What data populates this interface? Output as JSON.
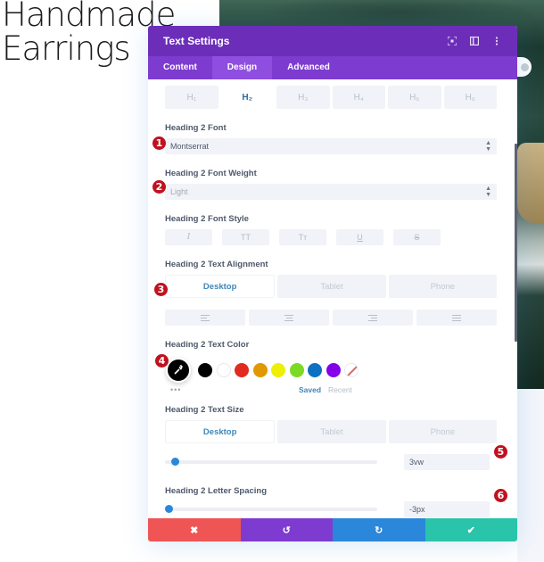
{
  "page": {
    "title_lines": [
      "Handmade",
      "Earrings"
    ]
  },
  "modal": {
    "title": "Text Settings",
    "header_icons": [
      "expand-icon",
      "split-view-icon",
      "more-options-icon"
    ],
    "tabs": [
      {
        "label": "Content",
        "active": false
      },
      {
        "label": "Design",
        "active": true
      },
      {
        "label": "Advanced",
        "active": false
      }
    ],
    "heading_levels": [
      {
        "label": "H₁",
        "active": false
      },
      {
        "label": "H₂",
        "active": true
      },
      {
        "label": "H₃",
        "active": false
      },
      {
        "label": "H₄",
        "active": false
      },
      {
        "label": "H₅",
        "active": false
      },
      {
        "label": "H₆",
        "active": false
      }
    ],
    "font": {
      "label": "Heading 2 Font",
      "value": "Montserrat"
    },
    "font_weight": {
      "label": "Heading 2 Font Weight",
      "value": "Light"
    },
    "font_style": {
      "label": "Heading 2 Font Style",
      "buttons": [
        "I",
        "TT",
        "Tт",
        "U",
        "S"
      ]
    },
    "text_alignment": {
      "label": "Heading 2 Text Alignment",
      "devices": [
        "Desktop",
        "Tablet",
        "Phone"
      ],
      "active_device": "Desktop",
      "options": [
        "align-left",
        "align-center",
        "align-right",
        "align-justify"
      ]
    },
    "text_color": {
      "label": "Heading 2 Text Color",
      "current": "#000000",
      "swatches": [
        "#000000",
        "#ffffff",
        "#e02b20",
        "#e09900",
        "#edf000",
        "#7cda24",
        "#0c71c3",
        "#8300e9"
      ],
      "more_label": "•••",
      "saved_label": "Saved",
      "recent_label": "Recent"
    },
    "text_size": {
      "label": "Heading 2 Text Size",
      "devices": [
        "Desktop",
        "Tablet",
        "Phone"
      ],
      "active_device": "Desktop",
      "value": "3vw",
      "slider_fraction": 0.03
    },
    "letter_spacing": {
      "label": "Heading 2 Letter Spacing",
      "value": "-3px",
      "slider_fraction": 0.0
    },
    "footer": {
      "cancel": "✖",
      "undo": "↺",
      "redo": "↻",
      "save": "✔"
    }
  },
  "markers": [
    "1",
    "2",
    "3",
    "4",
    "5",
    "6"
  ],
  "colors": {
    "header": "#6c2eb9",
    "tabs": "#7d3bcf",
    "accent": "#2b87da",
    "cancel": "#ef5555",
    "undo": "#7e3bd0",
    "redo": "#2b87da",
    "save": "#29c4a9",
    "marker": "#c0111f"
  }
}
